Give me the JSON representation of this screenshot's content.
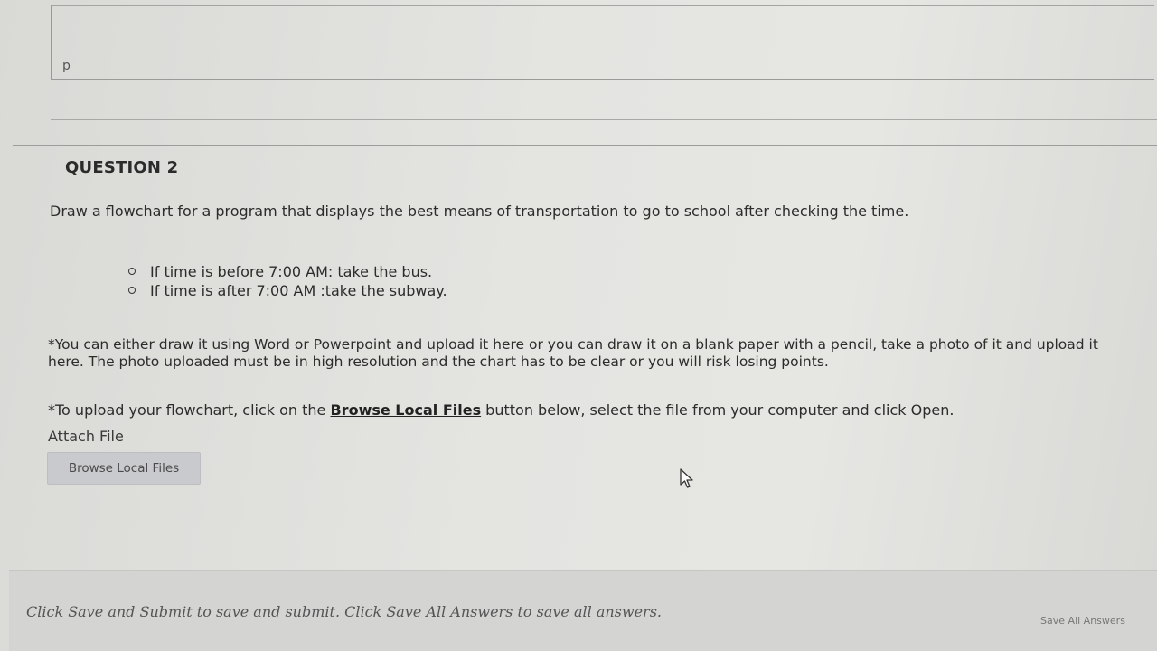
{
  "previous_answer": {
    "label": "p"
  },
  "question": {
    "title": "QUESTION 2",
    "prompt": "Draw a flowchart for a program that displays the best means of transportation to go to school after checking the time.",
    "bullets": [
      "If time is before 7:00 AM: take the bus.",
      "If time is after  7:00 AM :take the subway."
    ],
    "note": "*You can either draw it using Word or Powerpoint and upload it here or you can draw it on a blank paper with a pencil, take a photo of it and upload it here. The photo uploaded must be in high resolution and the chart has to be clear or you will risk losing points.",
    "upload_instruction_before": "*To upload your flowchart, click on the ",
    "upload_instruction_link": "Browse Local Files",
    "upload_instruction_after": " button below, select the file from your computer and click Open."
  },
  "attach": {
    "label": "Attach File",
    "browse_button": "Browse Local Files"
  },
  "footer": {
    "instruction": "Click Save and Submit to save and submit. Click Save All Answers to save all answers.",
    "save_all_button": "Save All Answers"
  }
}
